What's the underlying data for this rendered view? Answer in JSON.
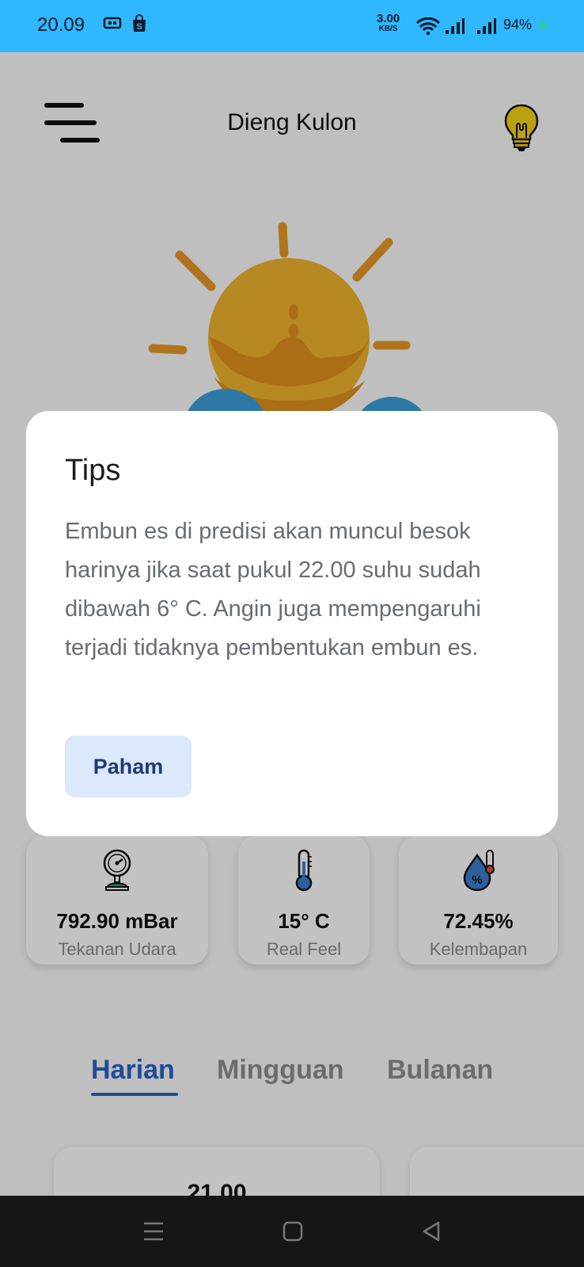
{
  "status_bar": {
    "time": "20.09",
    "net_speed_value": "3.00",
    "net_speed_unit": "KB/S",
    "battery": "94%"
  },
  "header": {
    "title": "Dieng Kulon",
    "menu_icon": "hamburger-menu-icon",
    "tips_icon": "lightbulb-icon"
  },
  "weather": {
    "icon": "sun-behind-cloud-icon"
  },
  "stats": [
    {
      "icon": "pressure-gauge-icon",
      "value": "792.90 mBar",
      "label": "Tekanan Udara"
    },
    {
      "icon": "thermometer-icon",
      "value": "15° C",
      "label": "Real Feel"
    },
    {
      "icon": "humidity-drop-icon",
      "value": "72.45%",
      "label": "Kelembapan"
    }
  ],
  "tabs": [
    {
      "label": "Harian",
      "active": true
    },
    {
      "label": "Mingguan",
      "active": false
    },
    {
      "label": "Bulanan",
      "active": false
    }
  ],
  "forecast": {
    "items": [
      {
        "time": "21.00"
      }
    ]
  },
  "dialog": {
    "title": "Tips",
    "body": "Embun es di predisi akan muncul besok harinya jika saat pukul 22.00 suhu sudah dibawah 6° C. Angin juga mempengaruhi terjadi tidaknya pembentukan embun es.",
    "button": "Paham"
  },
  "colors": {
    "status_bar": "#2fb8ff",
    "accent": "#2a64c8",
    "dialog_button_bg": "#dce9fd"
  }
}
